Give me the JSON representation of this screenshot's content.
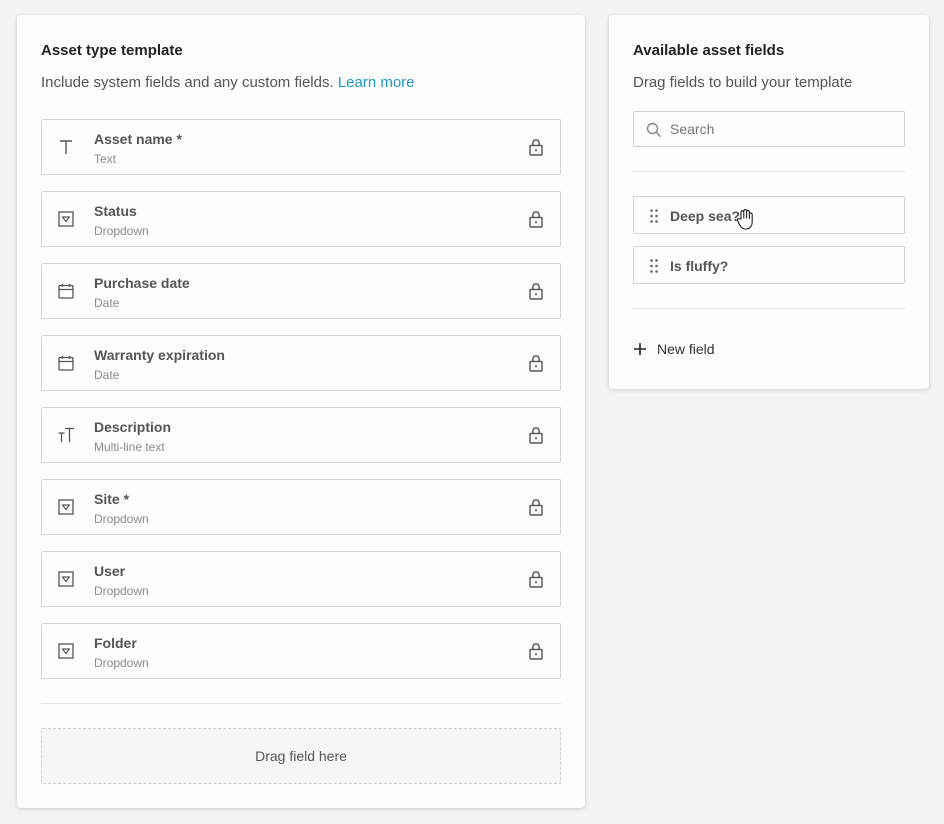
{
  "template_panel": {
    "title": "Asset type template",
    "subtitle": "Include system fields and any custom fields.",
    "learn_more": "Learn more",
    "fields": [
      {
        "name": "Asset name *",
        "type": "Text",
        "icon": "text-icon"
      },
      {
        "name": "Status",
        "type": "Dropdown",
        "icon": "dropdown-icon"
      },
      {
        "name": "Purchase date",
        "type": "Date",
        "icon": "calendar-icon"
      },
      {
        "name": "Warranty expiration",
        "type": "Date",
        "icon": "calendar-icon"
      },
      {
        "name": "Description",
        "type": "Multi-line text",
        "icon": "multiline-text-icon"
      },
      {
        "name": "Site *",
        "type": "Dropdown",
        "icon": "dropdown-icon"
      },
      {
        "name": "User",
        "type": "Dropdown",
        "icon": "dropdown-icon"
      },
      {
        "name": "Folder",
        "type": "Dropdown",
        "icon": "dropdown-icon"
      }
    ],
    "drop_zone": "Drag field here"
  },
  "available_panel": {
    "title": "Available asset fields",
    "subtitle": "Drag fields to build your template",
    "search_placeholder": "Search",
    "items": [
      {
        "name": "Deep sea?"
      },
      {
        "name": "Is fluffy?"
      }
    ],
    "new_field": "New field"
  },
  "colors": {
    "link": "#1f97c9",
    "background": "#f3f3f3",
    "panel": "#fdfdfc",
    "border": "#d4d4d2"
  }
}
